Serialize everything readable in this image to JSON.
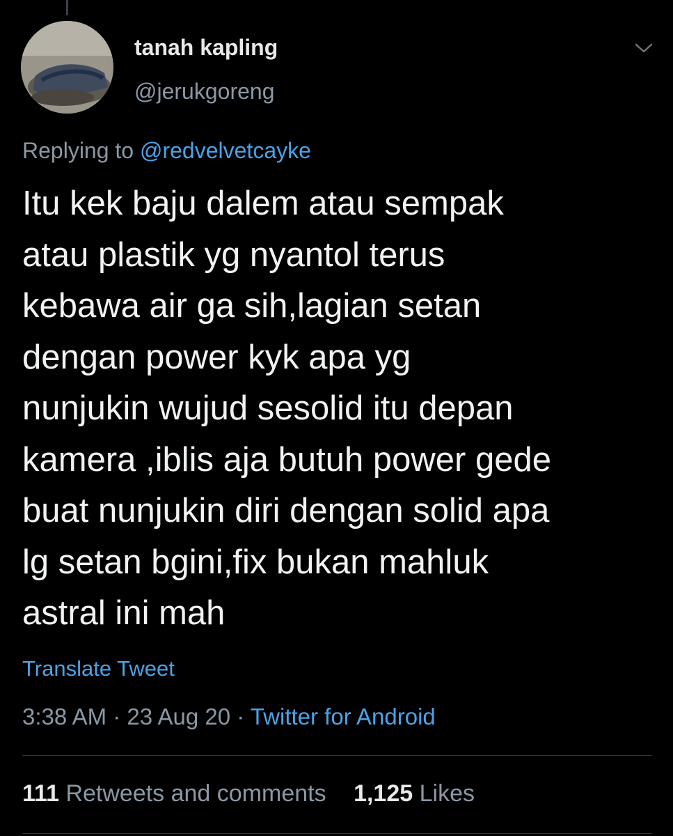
{
  "tweet": {
    "author": {
      "name": "tanah kapling",
      "handle": "@jerukgoreng"
    },
    "reply": {
      "prefix": "Replying to",
      "mention": "@redvelvetcayke"
    },
    "text": "Itu kek baju dalem atau sempak\natau plastik yg nyantol terus\nkebawa air ga sih,lagian setan\ndengan power kyk apa yg\nnunjukin wujud sesolid itu depan\nkamera ,iblis aja  butuh power gede\nbuat nunjukin diri dengan solid apa\nlg setan bgini,fix bukan mahluk\nastral ini mah",
    "translate_label": "Translate Tweet",
    "meta": {
      "time": "3:38 AM",
      "separator": "·",
      "date": "23 Aug 20",
      "source": "Twitter for Android"
    },
    "stats": {
      "retweets_count": "111",
      "retweets_label": "Retweets and comments",
      "likes_count": "1,125",
      "likes_label": "Likes"
    }
  },
  "icons": {
    "more": "chevron-down-icon",
    "avatar": "profile-photo"
  },
  "colors": {
    "background": "#000000",
    "link": "#4aa3e8",
    "secondary_text": "#8b98a5",
    "primary_text": "#e7e9ea"
  }
}
